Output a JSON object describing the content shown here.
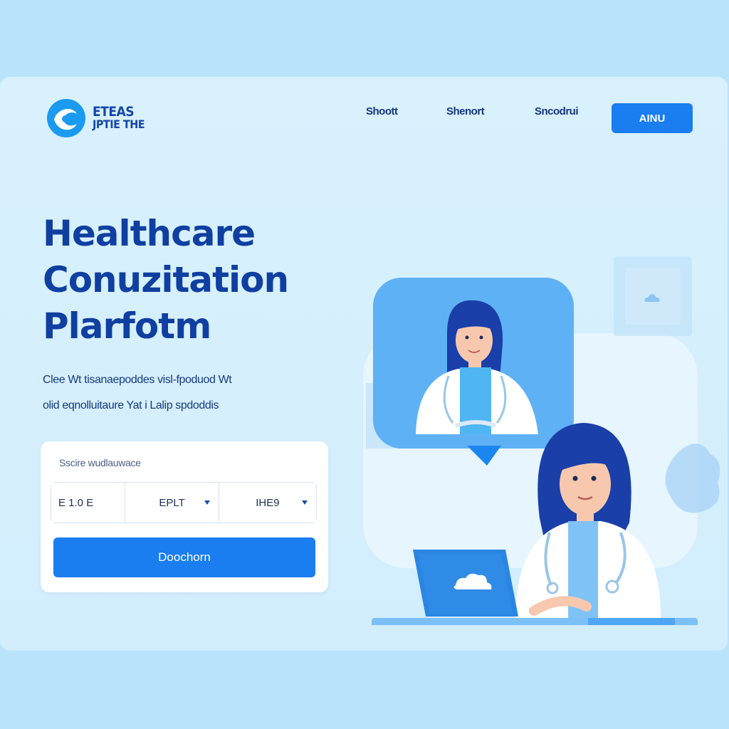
{
  "brand": {
    "name_line1": "ETEAS",
    "name_line2": "JPTIE THE",
    "accent_color": "#1a7df0",
    "logo_icon": "logo-swirl-icon"
  },
  "nav": {
    "links": [
      "Shoott",
      "Shenort",
      "Sncodrui"
    ],
    "cta_label": "AINU"
  },
  "hero": {
    "title_lines": [
      "Healthcare",
      "Conuzitation",
      "Plarfotm"
    ],
    "subtitle_lines": [
      "Clee Wt tisanaepoddes  visl-fpoduod Wt",
      "olid  eqnolluitaure Yat i Lalip spdoddis"
    ]
  },
  "booking": {
    "label": "Sscire  wudlauwace",
    "field1_value": "E 1.0    E",
    "field2_value": "EPLT",
    "field3_value": "IHE9",
    "button_label": "Doochorn"
  },
  "illustration": {
    "video_call_doctor_icon": "doctor-avatar-icon",
    "laptop_icon": "laptop-cloud-icon",
    "doctor_icon": "doctor-at-desk-icon"
  }
}
